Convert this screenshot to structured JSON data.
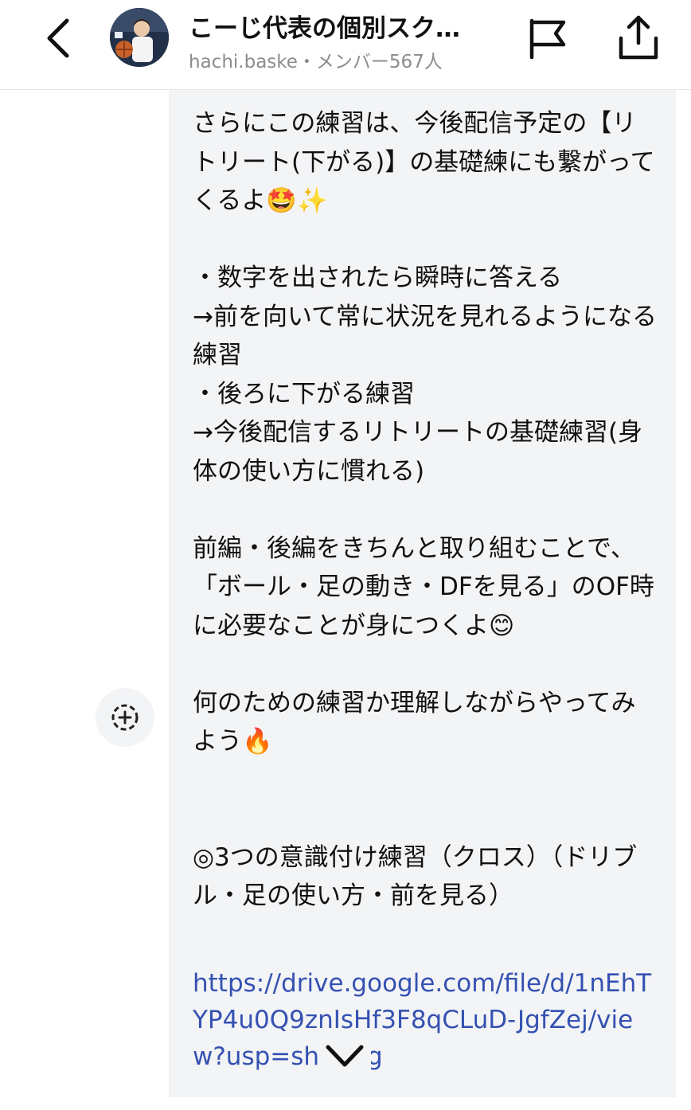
{
  "header": {
    "title": "こーじ代表の個別スク…",
    "subtitle": "hachi.baske・メンバー567人"
  },
  "message": {
    "text": "さらにこの練習は、今後配信予定の【リトリート(下がる)】の基礎練にも繋がってくるよ🤩✨\n\n・数字を出されたら瞬時に答える\n→前を向いて常に状況を見れるようになる練習\n・後ろに下がる練習\n→今後配信するリトリートの基礎練習(身体の使い方に慣れる)\n\n前編・後編をきちんと取り組むことで、「ボール・足の動き・DFを見る」のOF時に必要なことが身につくよ😊\n\n何のための練習か理解しながらやってみよう🔥\n\n\n◎3つの意識付け練習（クロス）（ドリブル・足の使い方・前を見る）",
    "link": "https://drive.google.com/file/d/1nEhTYP4u0Q9znIsHf3F8qCLuD-JgfZej/view?usp=sharing"
  },
  "icons": {
    "back": "chevron-left-icon",
    "flag": "flag-icon",
    "share": "share-icon",
    "reaction": "add-reaction-icon",
    "scroll": "chevron-down-icon"
  },
  "colors": {
    "link": "#3451b2",
    "bubble": "#f3f4f6"
  }
}
